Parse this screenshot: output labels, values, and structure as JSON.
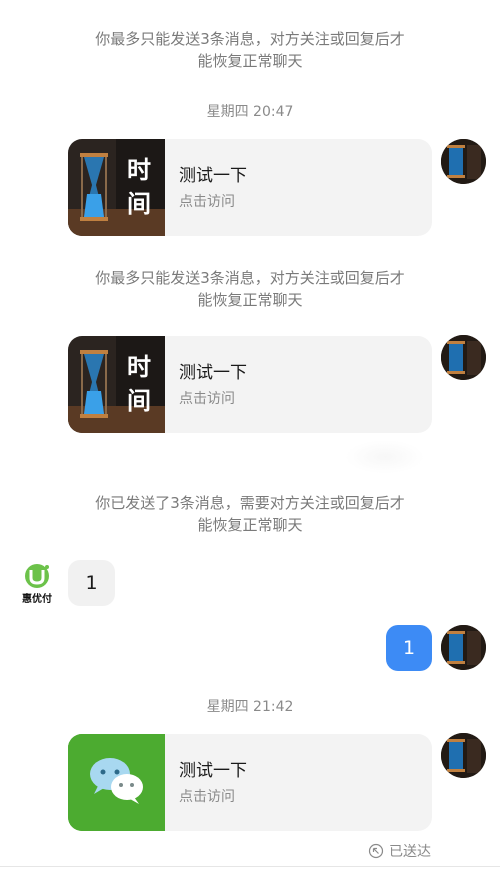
{
  "chat": {
    "notice_limit": "你最多只能发送3条消息，对方关注或回复后才能恢复正常聊天",
    "notice_sent": "你已发送了3条消息，需要对方关注或回复后才能恢复正常聊天",
    "time_1": "星期四 20:47",
    "time_2": "星期四 21:42",
    "card_title": "测试一下",
    "card_subtitle": "点击访问",
    "thumb_text": "时间",
    "incoming_message": "1",
    "outgoing_message": "1",
    "contact_avatar_text": "惠优付",
    "delivery_status": "已送达"
  },
  "icons": {
    "wechat": "wechat-icon",
    "status": "delivered-icon"
  },
  "colors": {
    "bubble_self": "#3d8bf5",
    "bubble_other": "#f1f1f1",
    "card_bg": "#f3f3f3",
    "wechat_green": "#4cab30"
  }
}
